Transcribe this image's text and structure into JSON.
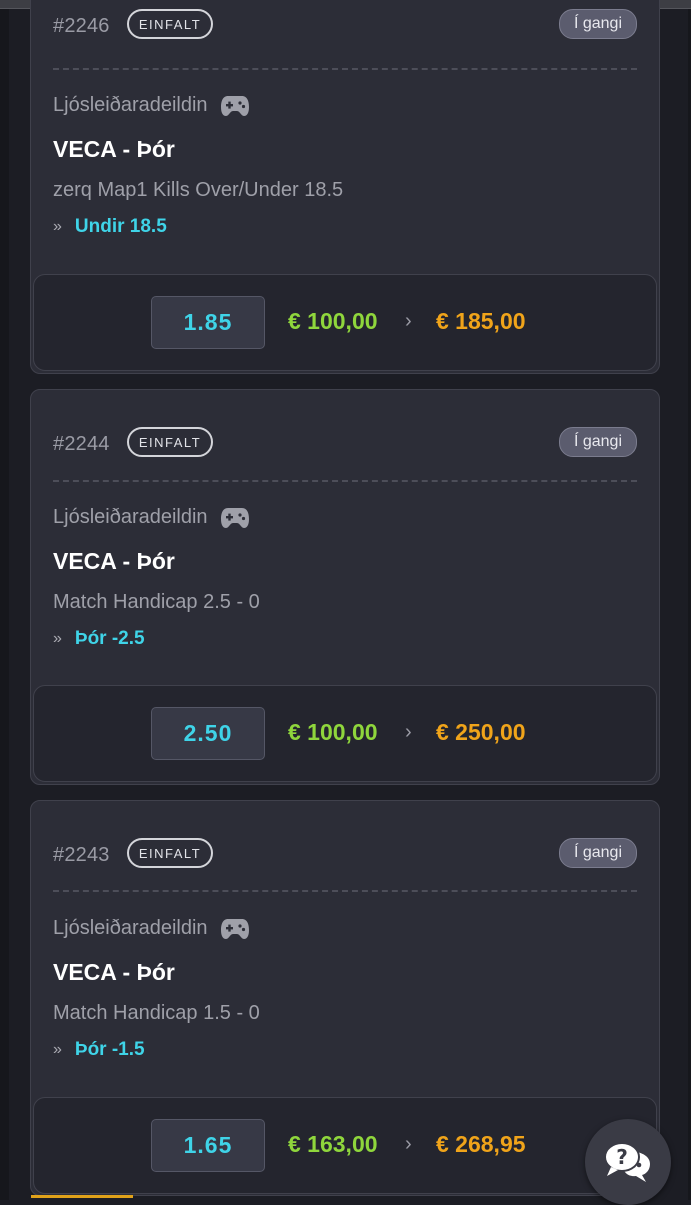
{
  "tickets": [
    {
      "id": "#2246",
      "type": "EINFALT",
      "status": "Í gangi",
      "league": "Ljósleiðaradeildin",
      "league_icon": "gamepad-icon",
      "teams": "VECA - Þór",
      "market": "zerq Map1 Kills Over/Under 18.5",
      "selection_marker": "»",
      "selection": "Undir 18.5",
      "odds": "1.85",
      "stake": "€ 100,00",
      "separator": "›",
      "payout": "€ 185,00"
    },
    {
      "id": "#2244",
      "type": "EINFALT",
      "status": "Í gangi",
      "league": "Ljósleiðaradeildin",
      "league_icon": "gamepad-icon",
      "teams": "VECA - Þór",
      "market": "Match Handicap 2.5 - 0",
      "selection_marker": "»",
      "selection": "Þór -2.5",
      "odds": "2.50",
      "stake": "€ 100,00",
      "separator": "›",
      "payout": "€ 250,00"
    },
    {
      "id": "#2243",
      "type": "EINFALT",
      "status": "Í gangi",
      "league": "Ljósleiðaradeildin",
      "league_icon": "gamepad-icon",
      "teams": "VECA - Þór",
      "market": "Match Handicap 1.5 - 0",
      "selection_marker": "»",
      "selection": "Þór -1.5",
      "odds": "1.65",
      "stake": "€ 163,00",
      "separator": "›",
      "payout": "€ 268,95"
    }
  ],
  "help_button": {
    "icon": "chat-help-icon"
  },
  "colors": {
    "background": "#1c1d24",
    "card": "#2c2d37",
    "odds_text": "#3fd4e8",
    "stake_text": "#8fd63c",
    "payout_text": "#f0a41a",
    "status_badge": "#5b5c6e"
  }
}
